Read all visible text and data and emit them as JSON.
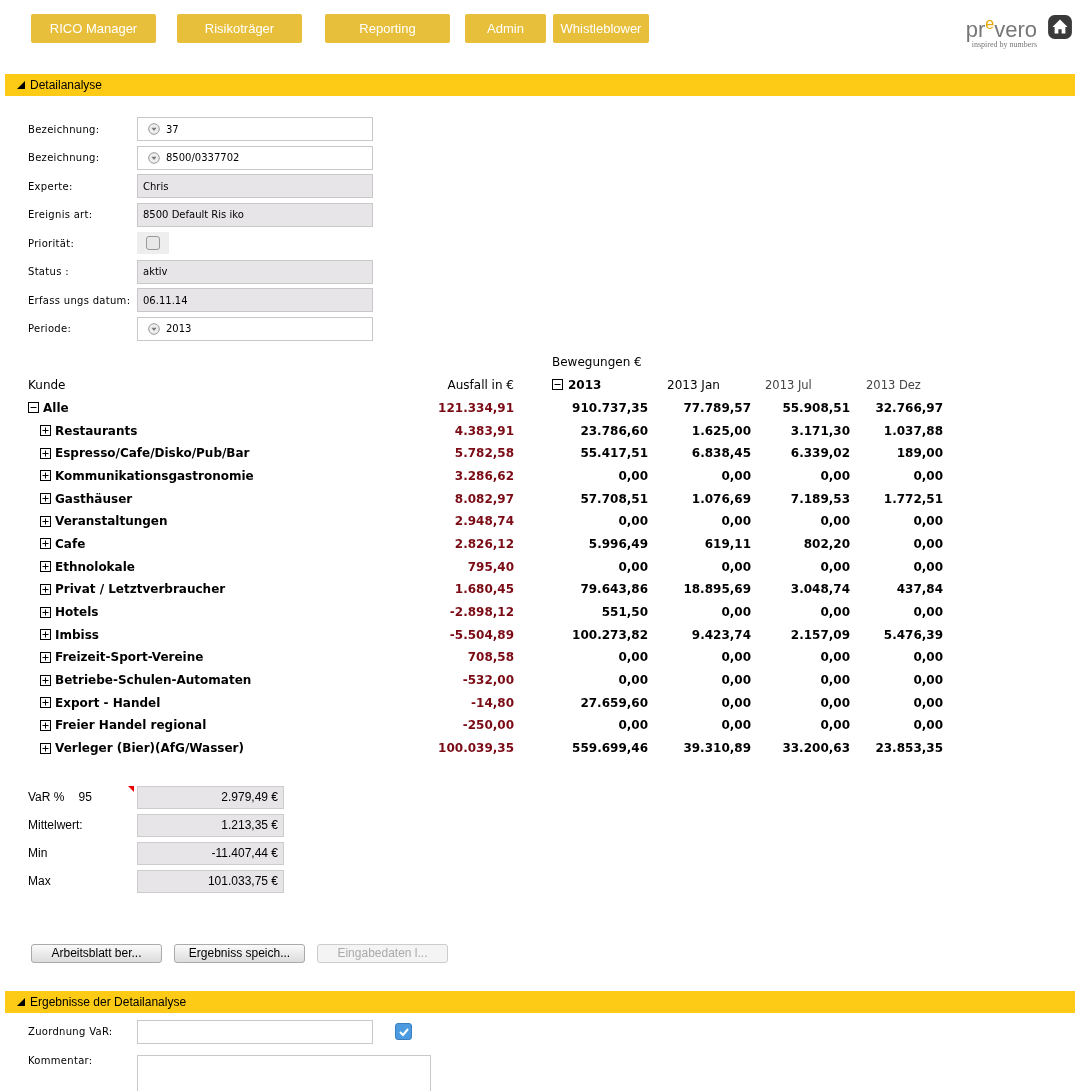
{
  "nav": [
    {
      "label": "RICO Manager"
    },
    {
      "label": "Risikoträger"
    },
    {
      "label": "Reporting"
    },
    {
      "label": "Admin"
    },
    {
      "label": "Whistleblower"
    }
  ],
  "logo": {
    "name": "pr$^{e}$vero",
    "tagline": "inspired by numbers"
  },
  "section1": {
    "title": "Detailanalyse",
    "expanded": true
  },
  "form": [
    {
      "label": "Bezeichnung:",
      "kind": "select",
      "value": "37"
    },
    {
      "label": "Bezeichnung:",
      "kind": "select",
      "value": "8500/0337702"
    },
    {
      "label": "Experte:",
      "kind": "readonly",
      "value": "Chris"
    },
    {
      "label": "Ereignis art:",
      "kind": "readonly",
      "value": "8500 Default Ris iko"
    },
    {
      "label": "Priorität:",
      "kind": "checkbox",
      "checked": false
    },
    {
      "label": "Status :",
      "kind": "readonly",
      "value": "aktiv"
    },
    {
      "label": "Erfass ungs datum:",
      "kind": "readonly",
      "value": "06.11.14"
    },
    {
      "label": "Periode:",
      "kind": "select",
      "value": "2013"
    }
  ],
  "table": {
    "group_header": "Bewegungen €",
    "columns": [
      "Kunde",
      "Ausfall in €",
      "2013",
      "2013 Jan",
      "2013 Jul",
      "2013 Dez"
    ],
    "year_expanded": true,
    "rows": [
      {
        "name": "Alle",
        "expanded": true,
        "ausfall": "121.334,91",
        "values": [
          "910.737,35",
          "77.789,57",
          "55.908,51",
          "32.766,97"
        ],
        "children": [
          {
            "name": "Restaurants",
            "expanded": false,
            "ausfall": "4.383,91",
            "values": [
              "23.786,60",
              "1.625,00",
              "3.171,30",
              "1.037,88"
            ]
          },
          {
            "name": "Espresso/Cafe/Disko/Pub/Bar",
            "expanded": false,
            "ausfall": "5.782,58",
            "values": [
              "55.417,51",
              "6.838,45",
              "6.339,02",
              "189,00"
            ]
          },
          {
            "name": "Kommunikationsgastronomie",
            "expanded": false,
            "ausfall": "3.286,62",
            "values": [
              "0,00",
              "0,00",
              "0,00",
              "0,00"
            ]
          },
          {
            "name": "Gasthäuser",
            "expanded": false,
            "ausfall": "8.082,97",
            "values": [
              "57.708,51",
              "1.076,69",
              "7.189,53",
              "1.772,51"
            ]
          },
          {
            "name": "Veranstaltungen",
            "expanded": false,
            "ausfall": "2.948,74",
            "values": [
              "0,00",
              "0,00",
              "0,00",
              "0,00"
            ]
          },
          {
            "name": "Cafe",
            "expanded": false,
            "ausfall": "2.826,12",
            "values": [
              "5.996,49",
              "619,11",
              "802,20",
              "0,00"
            ]
          },
          {
            "name": "Ethnolokale",
            "expanded": false,
            "ausfall": "795,40",
            "values": [
              "0,00",
              "0,00",
              "0,00",
              "0,00"
            ]
          },
          {
            "name": "Privat / Letztverbraucher",
            "expanded": false,
            "ausfall": "1.680,45",
            "values": [
              "79.643,86",
              "18.895,69",
              "3.048,74",
              "437,84"
            ]
          },
          {
            "name": "Hotels",
            "expanded": false,
            "ausfall": "-2.898,12",
            "values": [
              "551,50",
              "0,00",
              "0,00",
              "0,00"
            ]
          },
          {
            "name": "Imbiss",
            "expanded": false,
            "ausfall": "-5.504,89",
            "values": [
              "100.273,82",
              "9.423,74",
              "2.157,09",
              "5.476,39"
            ]
          },
          {
            "name": "Freizeit-Sport-Vereine",
            "expanded": false,
            "ausfall": "708,58",
            "values": [
              "0,00",
              "0,00",
              "0,00",
              "0,00"
            ]
          },
          {
            "name": "Betriebe-Schulen-Automaten",
            "expanded": false,
            "ausfall": "-532,00",
            "values": [
              "0,00",
              "0,00",
              "0,00",
              "0,00"
            ]
          },
          {
            "name": "Export - Handel",
            "expanded": false,
            "ausfall": "-14,80",
            "values": [
              "27.659,60",
              "0,00",
              "0,00",
              "0,00"
            ]
          },
          {
            "name": "Freier Handel regional",
            "expanded": false,
            "ausfall": "-250,00",
            "values": [
              "0,00",
              "0,00",
              "0,00",
              "0,00"
            ]
          },
          {
            "name": "Verleger (Bier)(AfG/Wasser)",
            "expanded": false,
            "ausfall": "100.039,35",
            "values": [
              "559.699,46",
              "39.310,89",
              "33.200,63",
              "23.853,35"
            ]
          }
        ]
      }
    ]
  },
  "stats": [
    {
      "label": "VaR %",
      "extra": "95",
      "value": "2.979,49 €",
      "flagged": true
    },
    {
      "label": "Mittelwert:",
      "value": "1.213,35 €",
      "flagged": false
    },
    {
      "label": "Min",
      "value": "-11.407,44 €",
      "flagged": false
    },
    {
      "label": "Max",
      "value": "101.033,75 €",
      "flagged": false
    }
  ],
  "buttons": [
    {
      "label": "Arbeitsblatt ber...",
      "disabled": false
    },
    {
      "label": "Ergebniss speich...",
      "disabled": false
    },
    {
      "label": "Eingabedaten l...",
      "disabled": true
    }
  ],
  "section2": {
    "title": "Ergebnisse der Detailanalyse",
    "expanded": true
  },
  "results": {
    "assignment_label": "Zuordnung VaR:",
    "assignment_checked": true,
    "comment_label": "Kommentar:"
  }
}
